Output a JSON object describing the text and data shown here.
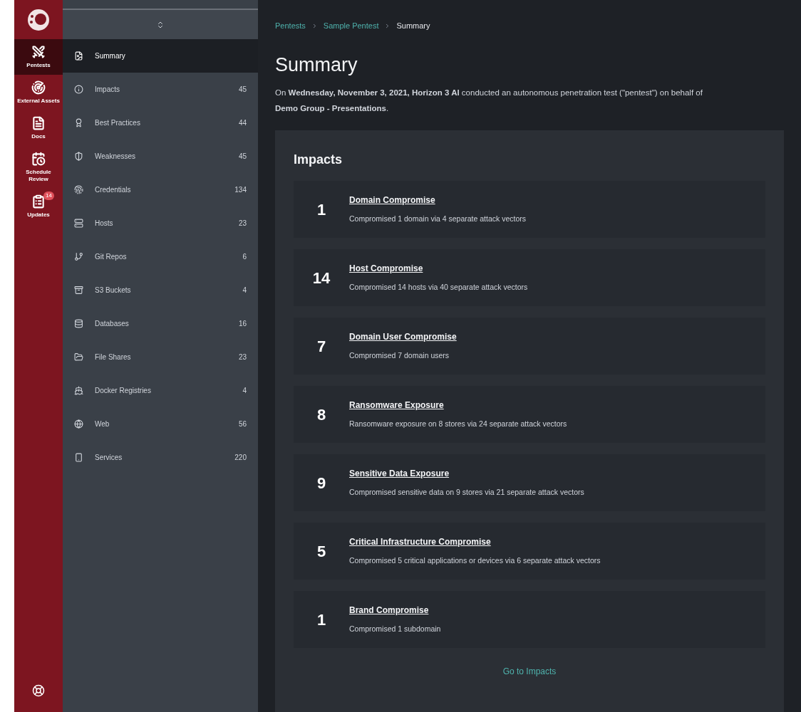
{
  "rail": {
    "items": [
      {
        "label": "Pentests",
        "selected": true
      },
      {
        "label": "External Assets",
        "selected": false
      },
      {
        "label": "Docs",
        "selected": false
      },
      {
        "label": "Schedule Review",
        "selected": false
      },
      {
        "label": "Updates",
        "selected": false,
        "badge": "14"
      }
    ]
  },
  "sidebar": {
    "items": [
      {
        "label": "Summary",
        "selected": true
      },
      {
        "label": "Impacts",
        "count": "45",
        "selected": false
      },
      {
        "label": "Best Practices",
        "count": "44",
        "selected": false
      },
      {
        "label": "Weaknesses",
        "count": "45",
        "selected": false
      },
      {
        "label": "Credentials",
        "count": "134",
        "selected": false
      },
      {
        "label": "Hosts",
        "count": "23",
        "selected": false
      },
      {
        "label": "Git Repos",
        "count": "6",
        "selected": false
      },
      {
        "label": "S3 Buckets",
        "count": "4",
        "selected": false
      },
      {
        "label": "Databases",
        "count": "16",
        "selected": false
      },
      {
        "label": "File Shares",
        "count": "23",
        "selected": false
      },
      {
        "label": "Docker Registries",
        "count": "4",
        "selected": false
      },
      {
        "label": "Web",
        "count": "56",
        "selected": false
      },
      {
        "label": "Services",
        "count": "220",
        "selected": false
      }
    ]
  },
  "breadcrumb": [
    "Pentests",
    "Sample Pentest",
    "Summary"
  ],
  "title": "Summary",
  "description": "On **Wednesday, November 3, 2021, Horizon 3 AI** conducted an autonomous penetration test (\"pentest\") on behalf of **Demo Group - Presentations**.",
  "impacts": {
    "title": "Impacts",
    "items": [
      {
        "count": "1",
        "name": "Domain Compromise",
        "detail": "Compromised 1 domain via 4 separate attack vectors"
      },
      {
        "count": "14",
        "name": "Host Compromise",
        "detail": "Compromised 14 hosts via 40 separate attack vectors"
      },
      {
        "count": "7",
        "name": "Domain User Compromise",
        "detail": "Compromised 7 domain users"
      },
      {
        "count": "8",
        "name": "Ransomware Exposure",
        "detail": "Ransomware exposure on 8 stores via 24 separate attack vectors"
      },
      {
        "count": "9",
        "name": "Sensitive Data Exposure",
        "detail": "Compromised sensitive data on 9 stores via 21 separate attack vectors"
      },
      {
        "count": "5",
        "name": "Critical Infrastructure Compromise",
        "detail": "Compromised 5 critical applications or devices via 6 separate attack vectors"
      },
      {
        "count": "1",
        "name": "Brand Compromise",
        "detail": "Compromised 1 subdomain"
      }
    ],
    "link": "Go to Impacts"
  }
}
